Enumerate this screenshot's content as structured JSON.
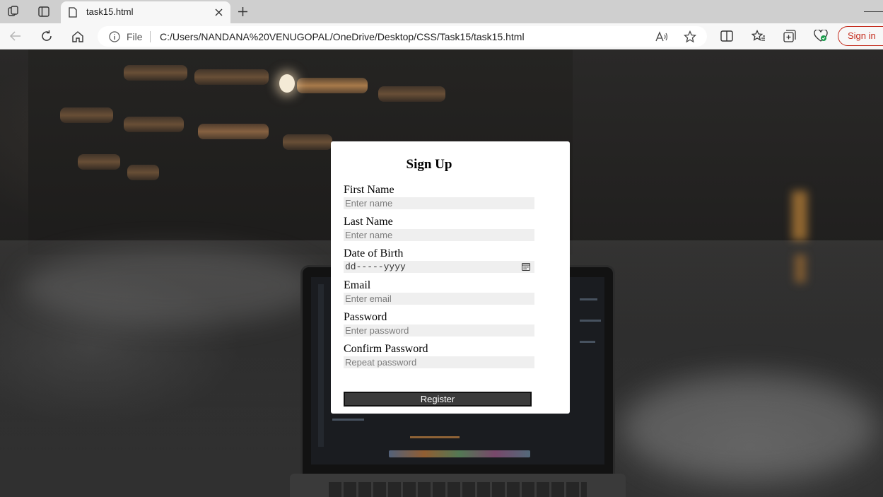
{
  "browser": {
    "tab_title": "task15.html",
    "address": {
      "scheme_label": "File",
      "url": "C:/Users/NANDANA%20VENUGOPAL/OneDrive/Desktop/CSS/Task15/task15.html"
    },
    "signin_label": "Sign in"
  },
  "form": {
    "title": "Sign Up",
    "fields": [
      {
        "label": "First Name",
        "placeholder": "Enter name"
      },
      {
        "label": "Last Name",
        "placeholder": "Enter name"
      },
      {
        "label": "Date of Birth",
        "placeholder": "dd-----yyyy"
      },
      {
        "label": "Email",
        "placeholder": "Enter email"
      },
      {
        "label": "Password",
        "placeholder": "Enter password"
      },
      {
        "label": "Confirm Password",
        "placeholder": "Repeat password"
      }
    ],
    "submit_label": "Register"
  },
  "colors": {
    "signin_accent": "#c42b1c",
    "button_bg": "#3b3b3b",
    "input_bg": "#efefef"
  },
  "icons": [
    "workspaces-icon",
    "tab-actions-icon",
    "page-icon",
    "close-icon",
    "plus-icon",
    "back-icon",
    "refresh-icon",
    "home-icon",
    "info-icon",
    "read-aloud-icon",
    "favorite-star-icon",
    "split-screen-icon",
    "favorites-icon",
    "collections-icon",
    "browser-essentials-icon",
    "calendar-icon"
  ]
}
